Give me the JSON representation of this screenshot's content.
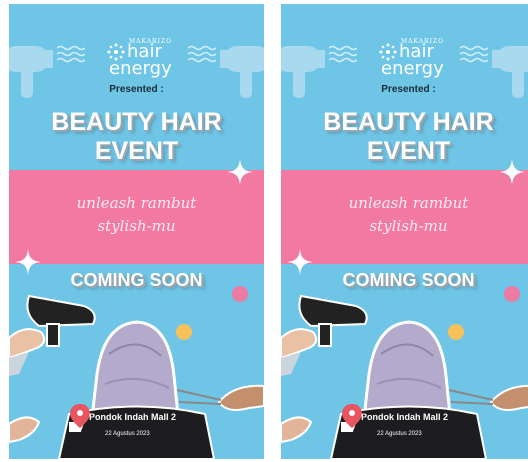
{
  "posters": [
    {
      "brand_small": "MAKARIZO",
      "brand_hair": "hair",
      "brand_energy": "energy",
      "presented": "Presented :",
      "title_line1": "BEAUTY HAIR",
      "title_line2": "EVENT",
      "tagline_line1": "unleash rambut",
      "tagline_line2": "stylish-mu",
      "coming_soon": "COMING SOON",
      "location": "Pondok Indah Mall 2",
      "date": "22 Agustus 2023"
    },
    {
      "brand_small": "MAKARIZO",
      "brand_hair": "hair",
      "brand_energy": "energy",
      "presented": "Presented :",
      "title_line1": "BEAUTY HAIR",
      "title_line2": "EVENT",
      "tagline_line1": "unleash rambut",
      "tagline_line2": "stylish-mu",
      "coming_soon": "COMING SOON",
      "location": "Pondok Indah Mall 2",
      "date": "22 Agustus 2023"
    }
  ],
  "colors": {
    "sky": "#6fc5e6",
    "pink_band": "#f27aa2",
    "title_text": "#ffffff",
    "presented_text": "#1e2a3a",
    "accent_yellow": "#f7c25a"
  },
  "icons": [
    "hair-dryer-icon",
    "wave-lines-icon",
    "sparkle-icon",
    "location-pin-icon",
    "brand-logo-icon"
  ]
}
